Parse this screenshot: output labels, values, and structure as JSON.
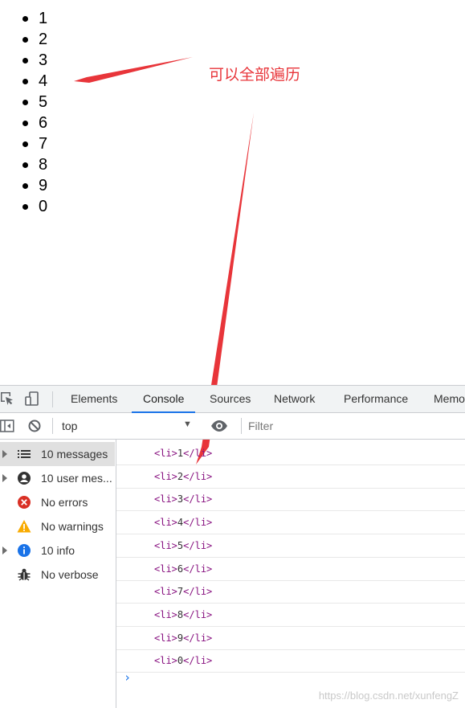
{
  "page": {
    "list_items": [
      "1",
      "2",
      "3",
      "4",
      "5",
      "6",
      "7",
      "8",
      "9",
      "0"
    ]
  },
  "annotation": {
    "text": "可以全部遍历",
    "color": "#e8353a"
  },
  "devtools": {
    "tabs": [
      "Elements",
      "Console",
      "Sources",
      "Network",
      "Performance",
      "Memo"
    ],
    "active_tab": "Console",
    "toolbar": {
      "context": "top",
      "filter_placeholder": "Filter"
    },
    "sidebar": [
      {
        "label": "10 messages",
        "icon": "list-icon",
        "expandable": true,
        "selected": true
      },
      {
        "label": "10 user mes...",
        "icon": "user-icon",
        "expandable": true,
        "selected": false
      },
      {
        "label": "No errors",
        "icon": "error-icon",
        "expandable": false,
        "selected": false
      },
      {
        "label": "No warnings",
        "icon": "warning-icon",
        "expandable": false,
        "selected": false
      },
      {
        "label": "10 info",
        "icon": "info-icon",
        "expandable": true,
        "selected": false
      },
      {
        "label": "No verbose",
        "icon": "bug-icon",
        "expandable": false,
        "selected": false
      }
    ],
    "messages": [
      "1",
      "2",
      "3",
      "4",
      "5",
      "6",
      "7",
      "8",
      "9",
      "0"
    ],
    "tag_open": "<li>",
    "tag_close": "</li>",
    "colors": {
      "accent": "#1a73e8",
      "tag": "#881280",
      "error": "#d93025",
      "warning": "#f9ab00",
      "info": "#1a73e8"
    }
  },
  "watermark": "https://blog.csdn.net/xunfengZ"
}
